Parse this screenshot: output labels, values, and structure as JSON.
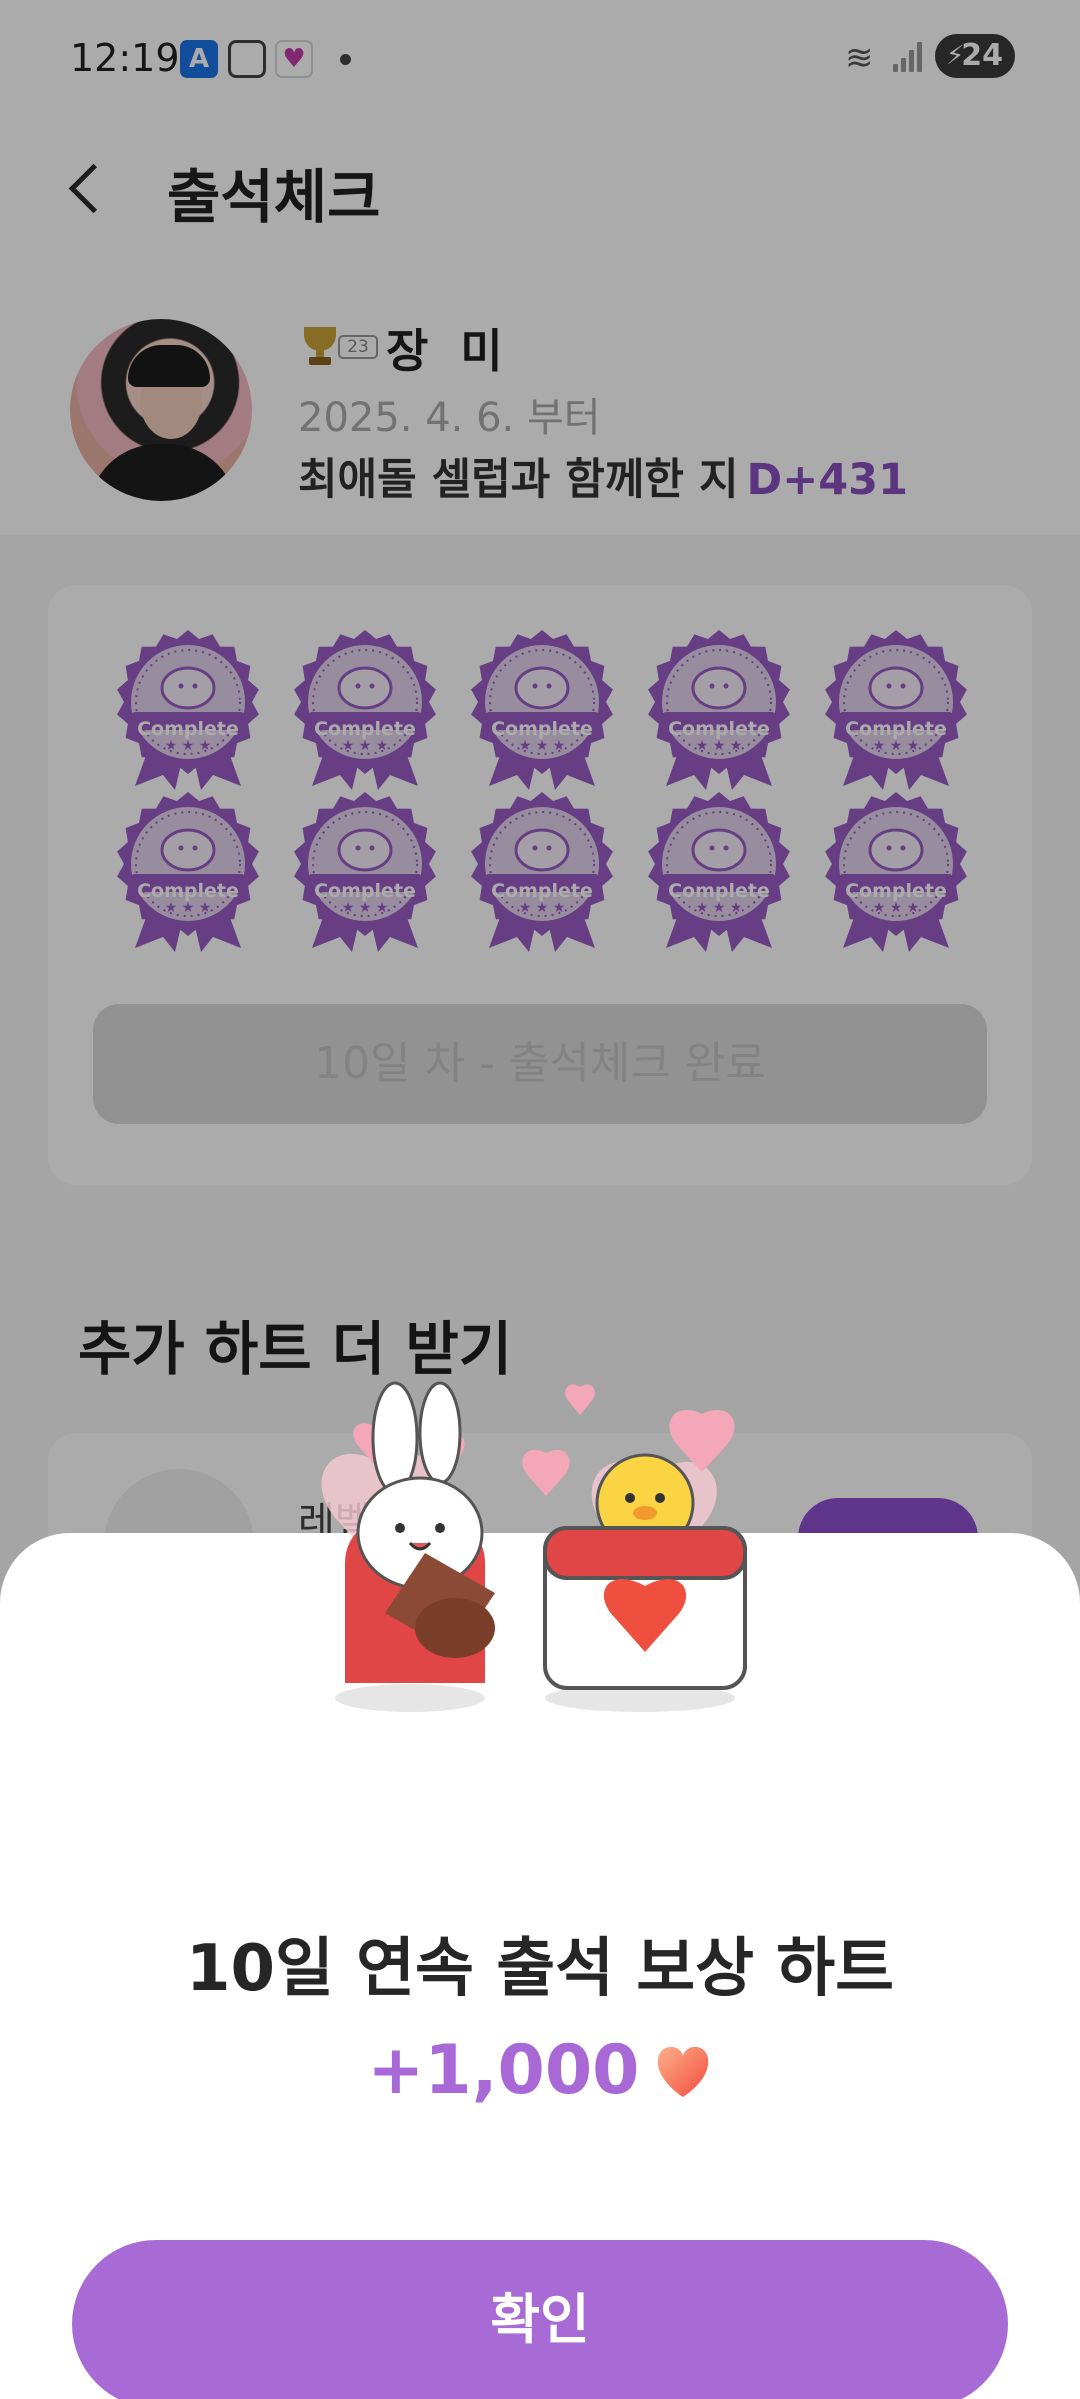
{
  "status_bar": {
    "time": "12:19",
    "app_icon_a": "A",
    "app_icon_heart": "♥",
    "battery_level": "24"
  },
  "header": {
    "title": "출석체크"
  },
  "profile": {
    "level": "23",
    "name": "장 미",
    "since": "2025. 4. 6. 부터",
    "together_text": "최애돌 셀럽과 함께한 지",
    "dday": "D+431"
  },
  "stamps": {
    "label": "Complete",
    "count": 10,
    "color": "#9a5bc4"
  },
  "attendance_status": "10일 차 - 출석체크 완료",
  "more_hearts": {
    "title": "추가 하트 더 받기",
    "mission_label": "레벨 보"
  },
  "reward_sheet": {
    "title": "10일 연속 출석 보상 하트",
    "amount": "+1,000",
    "confirm_label": "확인",
    "accent_color": "#a86bd6"
  }
}
